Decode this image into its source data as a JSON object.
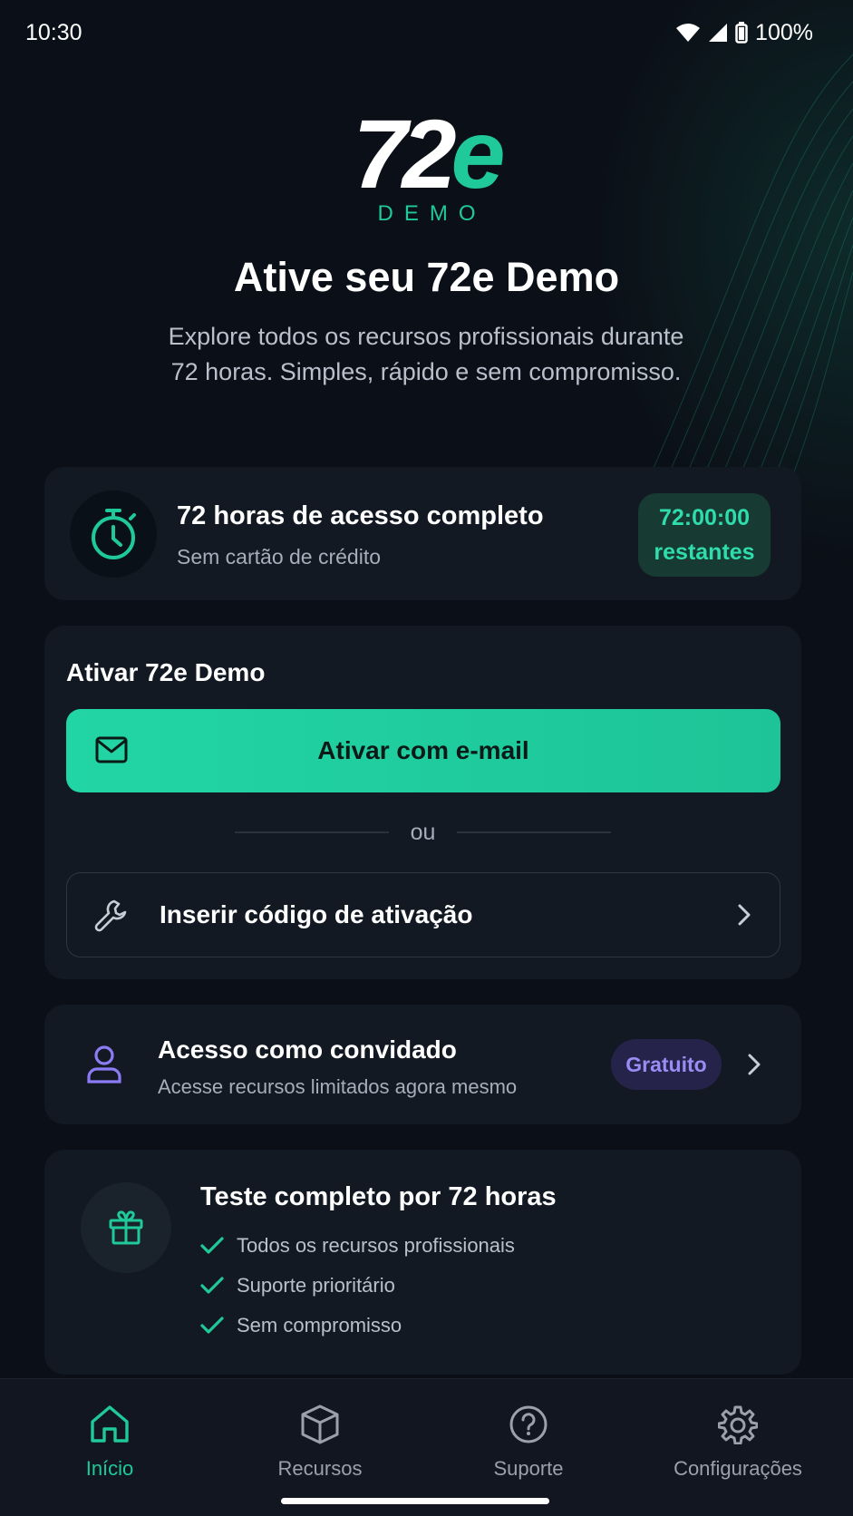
{
  "status_bar": {
    "time": "10:30",
    "battery": "100%"
  },
  "logo": {
    "mark_main": "72",
    "mark_accent": "e",
    "subtitle": "DEMO"
  },
  "hero": {
    "title": "Ative seu 72e Demo",
    "subtitle": "Explore todos os recursos profissionais durante 72 horas. Simples, rápido e sem compromisso."
  },
  "access_card": {
    "title": "72 horas de acesso completo",
    "subtitle": "Sem cartão de crédito",
    "countdown_time": "72:00:00",
    "countdown_label": "restantes",
    "icon": "stopwatch-icon"
  },
  "activate_card": {
    "heading": "Ativar 72e Demo",
    "email_button_label": "Ativar com e-mail",
    "divider_text": "ou",
    "code_button_label": "Inserir código de ativação"
  },
  "guest_card": {
    "title": "Acesso como convidado",
    "subtitle": "Acesse recursos limitados agora mesmo",
    "badge": "Gratuito"
  },
  "trial_card": {
    "title": "Teste completo por 72 horas",
    "features": [
      "Todos os recursos profissionais",
      "Suporte prioritário",
      "Sem compromisso"
    ]
  },
  "bottom_nav": {
    "items": [
      {
        "label": "Início",
        "icon": "home-icon",
        "active": true
      },
      {
        "label": "Recursos",
        "icon": "box-icon",
        "active": false
      },
      {
        "label": "Suporte",
        "icon": "help-icon",
        "active": false
      },
      {
        "label": "Configurações",
        "icon": "gear-icon",
        "active": false
      }
    ]
  },
  "colors": {
    "background": "#0b0f17",
    "card": "#131922",
    "accent": "#1fc99a",
    "guest_accent": "#8b7cf6",
    "text_secondary": "#a6aebb"
  }
}
